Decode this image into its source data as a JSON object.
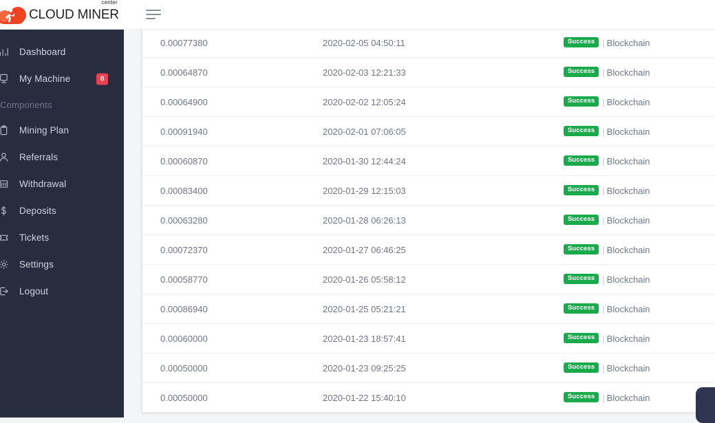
{
  "app": {
    "brand_center": "center",
    "brand_name": "CLOUD MINER",
    "menu_toggle_label": "Toggle navigation"
  },
  "sidebar": {
    "items": [
      {
        "label": "Dashboard",
        "icon": "bar-chart-icon",
        "badge": null
      },
      {
        "label": "My Machine",
        "icon": "server-icon",
        "badge": "0"
      }
    ],
    "section_label": "Components",
    "section_items": [
      {
        "label": "Mining Plan",
        "icon": "clipboard-icon"
      },
      {
        "label": "Referrals",
        "icon": "user-icon"
      },
      {
        "label": "Withdrawal",
        "icon": "bank-icon"
      },
      {
        "label": "Deposits",
        "icon": "dollar-icon"
      },
      {
        "label": "Tickets",
        "icon": "ticket-icon"
      },
      {
        "label": "Settings",
        "icon": "gear-icon"
      },
      {
        "label": "Logout",
        "icon": "logout-icon"
      }
    ]
  },
  "table": {
    "status_badge_label": "Success",
    "separator": "|",
    "link_label": "Blockchain",
    "rows": [
      {
        "amount": "0.00077380",
        "date": "2020-02-05 04:50:11"
      },
      {
        "amount": "0.00064870",
        "date": "2020-02-03 12:21:33"
      },
      {
        "amount": "0.00064900",
        "date": "2020-02-02 12:05:24"
      },
      {
        "amount": "0.00091940",
        "date": "2020-02-01 07:06:05"
      },
      {
        "amount": "0.00060870",
        "date": "2020-01-30 12:44:24"
      },
      {
        "amount": "0.00083400",
        "date": "2020-01-29 12:15:03"
      },
      {
        "amount": "0.00063280",
        "date": "2020-01-28 06:26:13"
      },
      {
        "amount": "0.00072370",
        "date": "2020-01-27 06:46:25"
      },
      {
        "amount": "0.00058770",
        "date": "2020-01-26 05:58:12"
      },
      {
        "amount": "0.00086940",
        "date": "2020-01-25 05:21:21"
      },
      {
        "amount": "0.00060000",
        "date": "2020-01-23 18:57:41"
      },
      {
        "amount": "0.00050000",
        "date": "2020-01-23 09:25:25"
      },
      {
        "amount": "0.00050000",
        "date": "2020-01-22 15:40:10"
      }
    ]
  },
  "colors": {
    "sidebar_bg": "#272c3f",
    "brand_red": "#ef4423",
    "badge_red": "#e8414f",
    "success_green": "#1aa94b",
    "page_bg": "#f4f5f7",
    "chat_widget": "#2f3450"
  }
}
